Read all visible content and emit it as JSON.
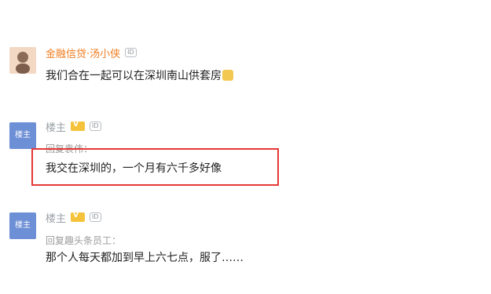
{
  "comments": [
    {
      "author": "金融信贷·汤小侠",
      "id_badge": "ID",
      "text": "我们合在一起可以在深圳南山供套房",
      "emoji_icon": "face-emoji-icon"
    },
    {
      "author": "楼主",
      "avatar_label": "楼主",
      "v_badge": "V",
      "id_badge": "ID",
      "reply_to": "回复袁伟：",
      "text": "我交在深圳的，一个月有六千多好像"
    },
    {
      "author": "楼主",
      "avatar_label": "楼主",
      "v_badge": "V",
      "id_badge": "ID",
      "reply_to": "回复趣头条员工：",
      "text": "那个人每天都加到早上六七点，服了……"
    }
  ],
  "colors": {
    "user_name": "#f07b1d",
    "host_name": "#9aa0a6",
    "host_avatar": "#6d8fd6",
    "highlight": "#e53935"
  }
}
